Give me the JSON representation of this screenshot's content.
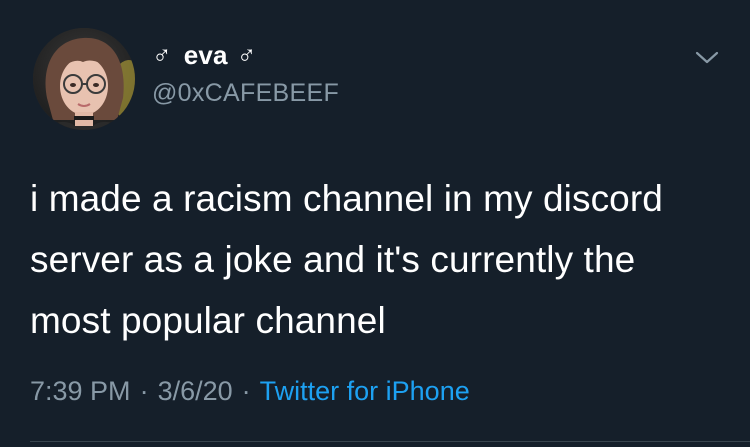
{
  "tweet": {
    "display_name": "eva",
    "name_prefix_symbol": "♂",
    "name_suffix_symbol": "♂",
    "handle": "@0xCAFEBEEF",
    "text_lines": [
      "i made a racism channel in my discord",
      "server as a joke and it's currently the",
      "most popular channel"
    ],
    "time": "7:39 PM",
    "separator": "·",
    "date": "3/6/20",
    "source": "Twitter for iPhone"
  },
  "icons": {
    "menu": "chevron-down-icon",
    "avatar": "profile-photo"
  },
  "colors": {
    "background": "#151f2a",
    "primary_text": "#ffffff",
    "secondary_text": "#8899a6",
    "link": "#1da1f2",
    "divider": "#38444d"
  }
}
